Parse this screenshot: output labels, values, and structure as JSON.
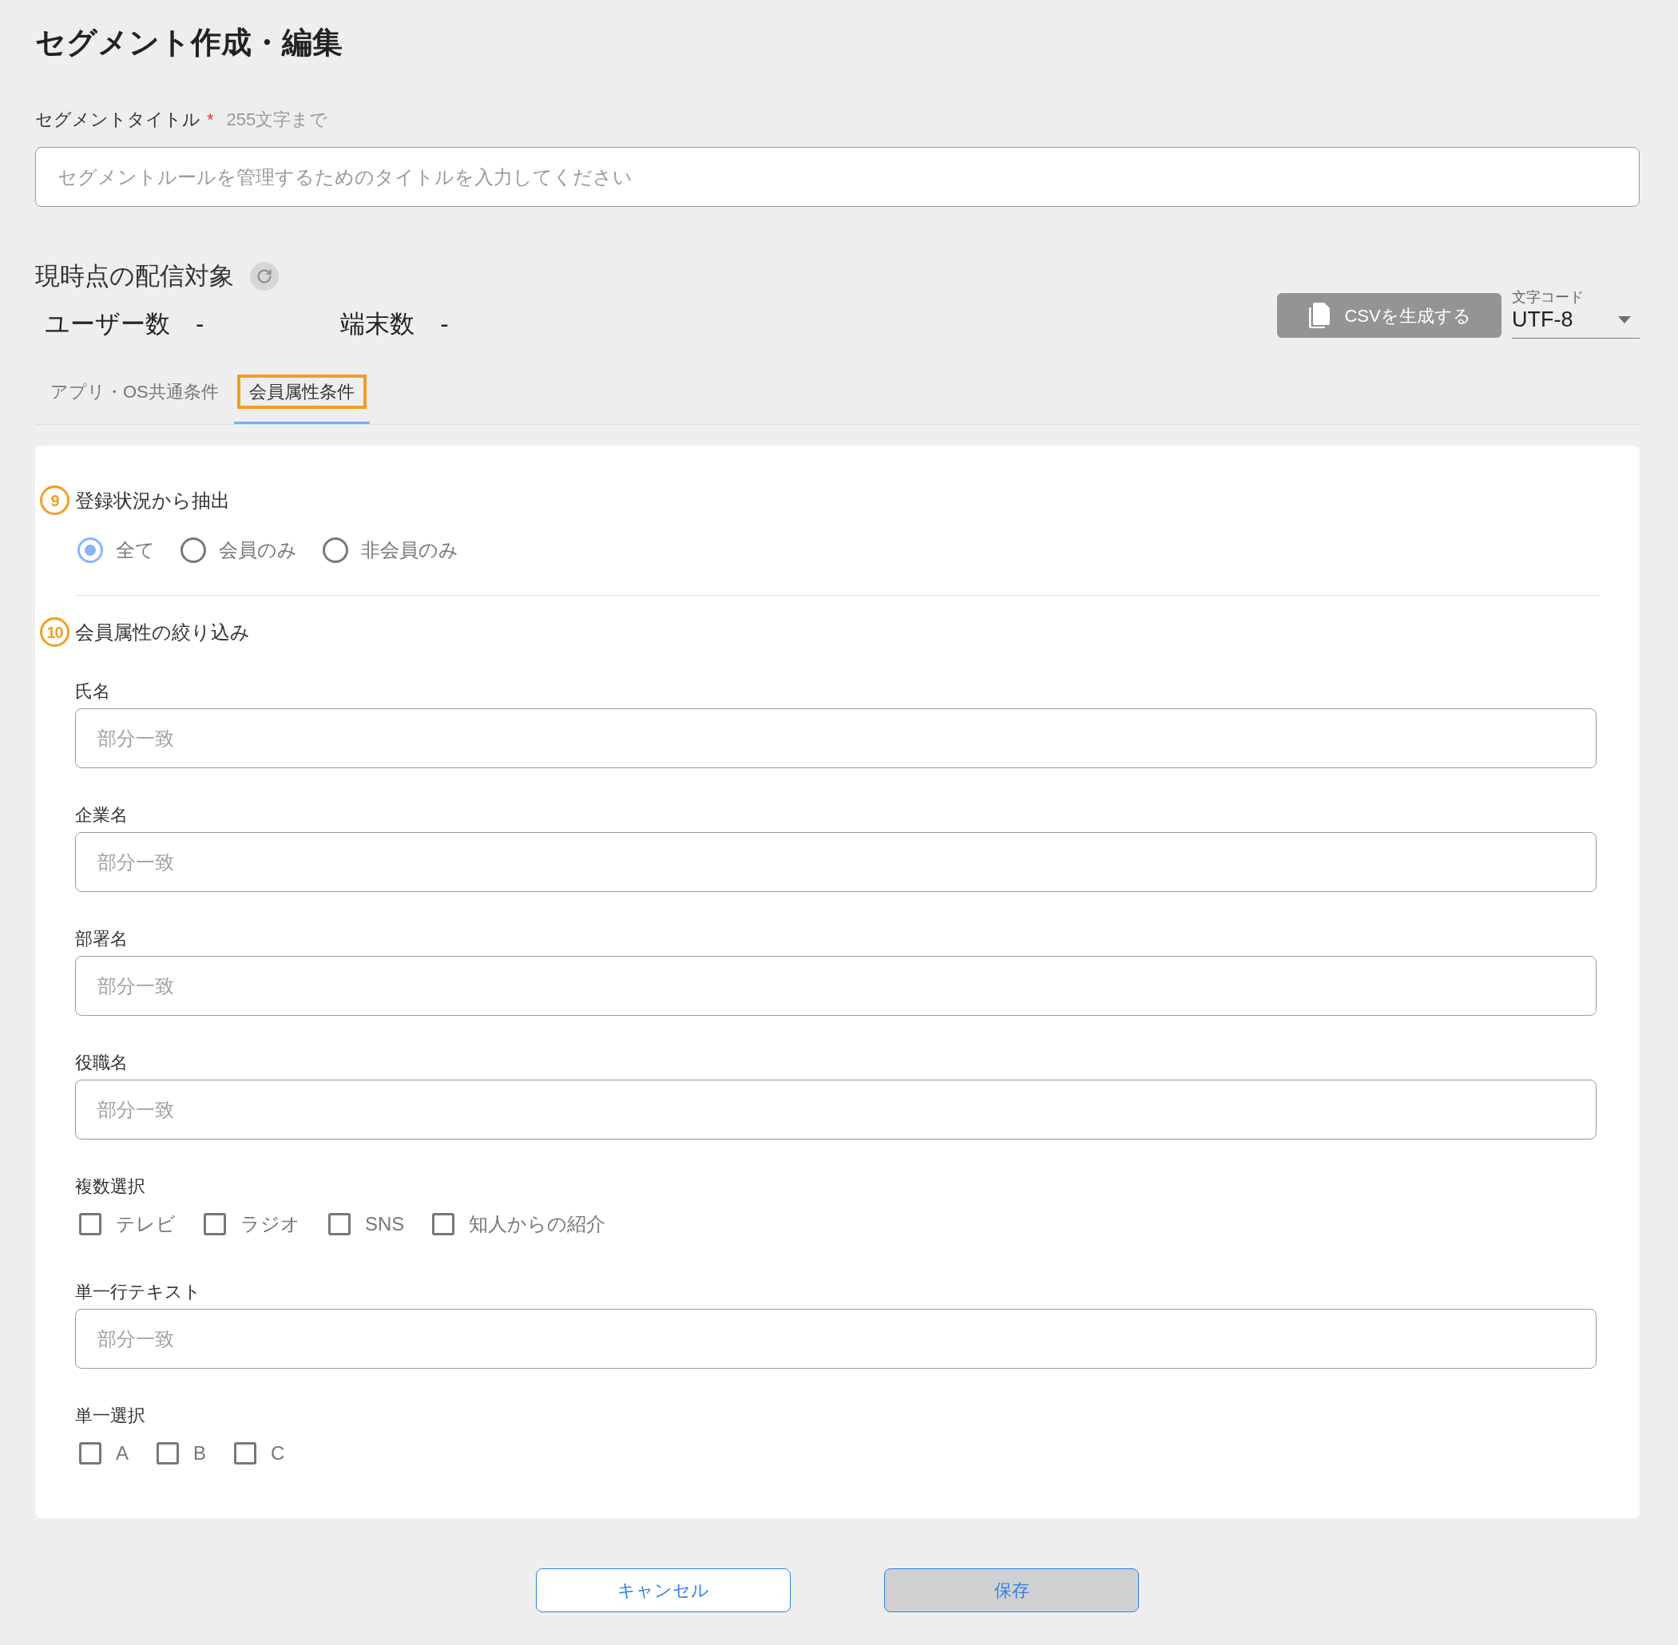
{
  "page": {
    "title": "セグメント作成・編集"
  },
  "segment_title": {
    "label": "セグメントタイトル",
    "required_mark": "*",
    "hint": "255文字まで",
    "placeholder": "セグメントルールを管理するためのタイトルを入力してください"
  },
  "audience": {
    "title": "現時点の配信対象",
    "counts": [
      {
        "label": "ユーザー数",
        "value": "-"
      },
      {
        "label": "端末数",
        "value": "-"
      }
    ],
    "csv_button": {
      "label": "CSVを生成する",
      "disabled": true
    },
    "encoding": {
      "label": "文字コード",
      "value": "UTF-8"
    }
  },
  "tabs": [
    {
      "label": "アプリ・OS共通条件",
      "selected": false,
      "highlighted": false
    },
    {
      "label": "会員属性条件",
      "selected": true,
      "highlighted": true
    }
  ],
  "sections": [
    {
      "number": "9",
      "title": "登録状況から抽出",
      "kind": "radios",
      "options": [
        {
          "label": "全て",
          "selected": true
        },
        {
          "label": "会員のみ",
          "selected": false
        },
        {
          "label": "非会員のみ",
          "selected": false
        }
      ]
    },
    {
      "number": "10",
      "title": "会員属性の絞り込み",
      "kind": "fields",
      "fields": [
        {
          "kind": "text",
          "label": "氏名",
          "placeholder": "部分一致"
        },
        {
          "kind": "text",
          "label": "企業名",
          "placeholder": "部分一致"
        },
        {
          "kind": "text",
          "label": "部署名",
          "placeholder": "部分一致"
        },
        {
          "kind": "text",
          "label": "役職名",
          "placeholder": "部分一致"
        },
        {
          "kind": "checkboxes",
          "label": "複数選択",
          "options": [
            {
              "label": "テレビ",
              "checked": false
            },
            {
              "label": "ラジオ",
              "checked": false
            },
            {
              "label": "SNS",
              "checked": false
            },
            {
              "label": "知人からの紹介",
              "checked": false
            }
          ]
        },
        {
          "kind": "text",
          "label": "単一行テキスト",
          "placeholder": "部分一致"
        },
        {
          "kind": "checkboxes",
          "label": "単一選択",
          "options": [
            {
              "label": "A",
              "checked": false
            },
            {
              "label": "B",
              "checked": false
            },
            {
              "label": "C",
              "checked": false
            }
          ]
        }
      ]
    }
  ],
  "buttons": [
    {
      "label": "キャンセル",
      "kind": "secondary",
      "disabled": false
    },
    {
      "label": "保存",
      "kind": "primary",
      "disabled": true
    }
  ]
}
